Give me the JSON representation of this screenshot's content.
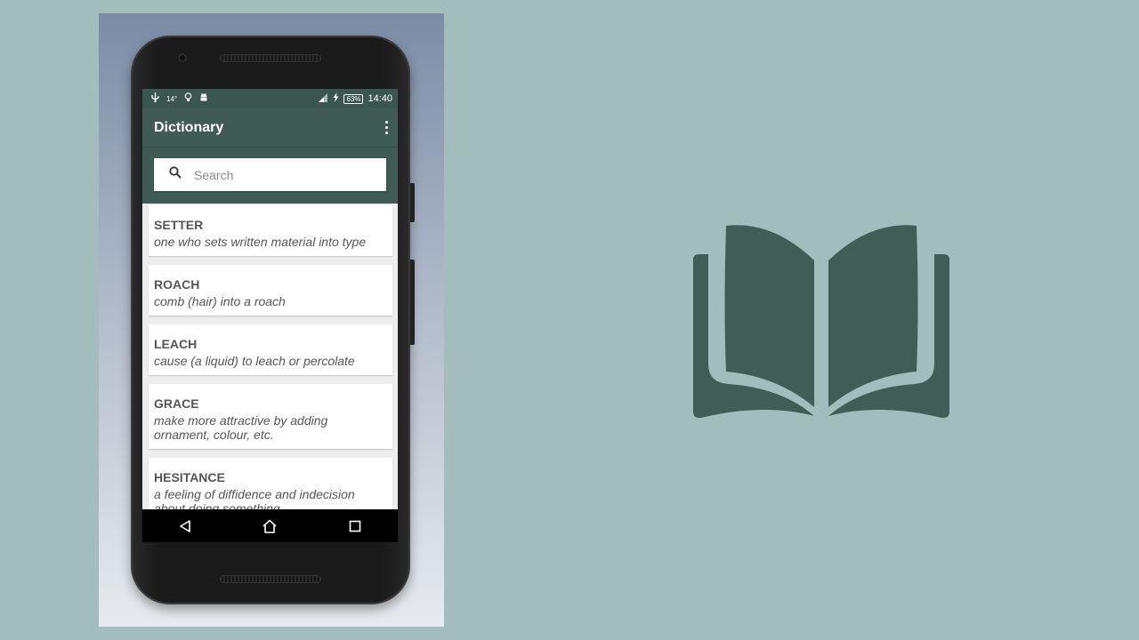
{
  "statusbar": {
    "temperature": "14°",
    "battery": "63%",
    "time": "14:40",
    "icons": [
      "usb-icon",
      "lightbulb-icon",
      "android-icon",
      "signal-icon",
      "charging-icon"
    ]
  },
  "appbar": {
    "title": "Dictionary",
    "menu_icon": "more-vert-icon"
  },
  "search": {
    "placeholder": "Search",
    "icon": "search-icon"
  },
  "entries": [
    {
      "word": "SETTER",
      "definition": "one who sets written material into type"
    },
    {
      "word": "ROACH",
      "definition": "comb (hair) into a roach"
    },
    {
      "word": "LEACH",
      "definition": "cause (a liquid) to leach or percolate"
    },
    {
      "word": "GRACE",
      "definition": "make more attractive by adding ornament, colour, etc."
    },
    {
      "word": "HESITANCE",
      "definition": "a feeling of diffidence and indecision about doing something"
    }
  ],
  "navbar": {
    "icons": [
      "back-icon",
      "home-icon",
      "recents-icon"
    ]
  },
  "colors": {
    "page_background": "#a3bdbc",
    "primary": "#405b54",
    "status_bar": "#3b564f",
    "book_icon": "#425c57"
  }
}
